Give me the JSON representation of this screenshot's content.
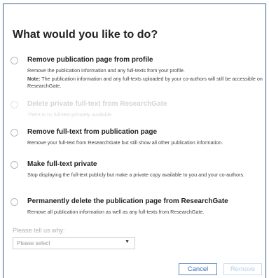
{
  "dialog": {
    "title": "What would you like to do?"
  },
  "options": [
    {
      "label": "Remove publication page from profile",
      "description": "Remove the publication information and any full-texts from your profile.",
      "note_prefix": "Note:",
      "note_text": " The publication information and any full-texts uploaded by your co-authors will still be accessible on ResearchGate.",
      "disabled": false
    },
    {
      "label": "Delete private full-text from ResearchGate",
      "description": "There is no full-text privately available",
      "disabled": true
    },
    {
      "label": "Remove full-text from publication page",
      "description": "Remove your full-text from ResearchGate but still show all other publication information.",
      "disabled": false
    },
    {
      "label": "Make full-text private",
      "description": "Stop displaying the full-text publicly but make a private copy available to you and your co-authors.",
      "disabled": false
    },
    {
      "label": "Permanently delete the publication page from ResearchGate",
      "description": "Remove all publication information as well as any full-texts from ResearchGate.",
      "disabled": false
    }
  ],
  "reason": {
    "label": "Please tell us why:",
    "selected": "Please select",
    "caret_icon": "chevron-down-icon"
  },
  "buttons": {
    "cancel": "Cancel",
    "remove": "Remove"
  },
  "colors": {
    "border": "#3a5f8f",
    "accent": "#3b6db5",
    "disabled_text": "#d5d5d5"
  }
}
